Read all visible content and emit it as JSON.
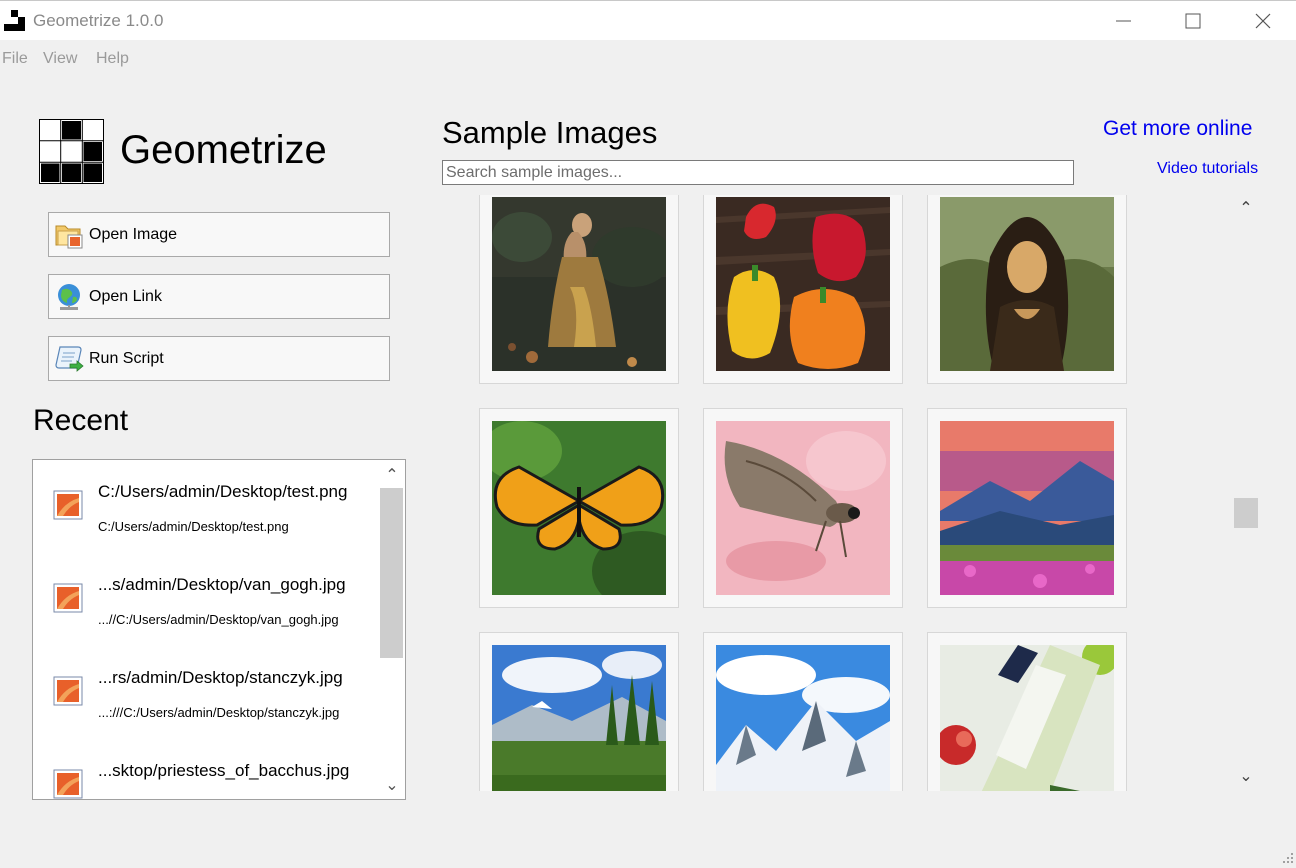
{
  "window": {
    "title": "Geometrize 1.0.0",
    "controls": {
      "minimize": "—",
      "maximize": "☐",
      "close": "✕"
    }
  },
  "menu": {
    "items": [
      "File",
      "View",
      "Help"
    ]
  },
  "sidebar": {
    "app_name": "Geometrize",
    "buttons": [
      {
        "label": "Open Image",
        "icon": "folder-image-icon"
      },
      {
        "label": "Open Link",
        "icon": "globe-icon"
      },
      {
        "label": "Run Script",
        "icon": "script-scroll-icon"
      }
    ],
    "recent": {
      "title": "Recent",
      "items": [
        {
          "name": "C:/Users/admin/Desktop/test.png",
          "path": "C:/Users/admin/Desktop/test.png"
        },
        {
          "name": "...s/admin/Desktop/van_gogh.jpg",
          "path": "...//C:/Users/admin/Desktop/van_gogh.jpg"
        },
        {
          "name": "...rs/admin/Desktop/stanczyk.jpg",
          "path": "...:///C:/Users/admin/Desktop/stanczyk.jpg"
        },
        {
          "name": "...sktop/priestess_of_bacchus.jpg",
          "path": ""
        }
      ]
    }
  },
  "samples": {
    "title": "Sample Images",
    "search_placeholder": "Search sample images...",
    "get_more": "Get more online",
    "video_tutorials": "Video tutorials",
    "images": [
      {
        "subject": "woman-in-dress"
      },
      {
        "subject": "bell-peppers"
      },
      {
        "subject": "mona-lisa"
      },
      {
        "subject": "monarch-butterfly"
      },
      {
        "subject": "moth-on-pink"
      },
      {
        "subject": "mountain-sunset"
      },
      {
        "subject": "alpine-meadow"
      },
      {
        "subject": "snowy-mountains"
      },
      {
        "subject": "wine-bottle"
      }
    ]
  },
  "colors": {
    "link": "#0000ee",
    "window_bg": "#f0f0f0",
    "muted_text": "#8a8a8a"
  }
}
